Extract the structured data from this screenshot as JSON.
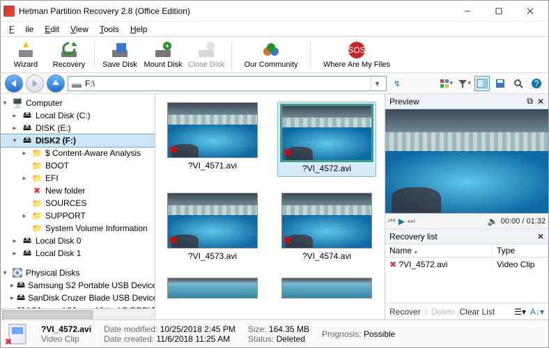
{
  "window": {
    "title": "Hetman Partition Recovery 2.8 (Office Edition)"
  },
  "menu": {
    "file": "File",
    "edit": "Edit",
    "view": "View",
    "tools": "Tools",
    "help": "Help"
  },
  "toolbar": {
    "wizard": "Wizard",
    "recovery": "Recovery",
    "save_disk": "Save Disk",
    "mount_disk": "Mount Disk",
    "close_disk": "Close Disk",
    "community": "Our Community",
    "where": "Where Are My Files"
  },
  "address": {
    "path": "F:\\"
  },
  "tree": {
    "computer": "Computer",
    "local_c": "Local Disk (C:)",
    "disk_e": "DISK (E:)",
    "disk2_f": "DISK2 (F:)",
    "content_aware": "$ Content-Aware Analysis",
    "boot": "BOOT",
    "efi": "EFI",
    "new_folder": "New folder",
    "sources": "SOURCES",
    "support": "SUPPORT",
    "svi": "System Volume Information",
    "ld0": "Local Disk 0",
    "ld1": "Local Disk 1",
    "physical": "Physical Disks",
    "samsung": "Samsung S2 Portable USB Device",
    "sandisk": "SanDisk Cruzer Blade USB Device",
    "vmware": "VMware, VMware Virtual S SCSI Di"
  },
  "files": [
    {
      "name": "?VI_4571.avi"
    },
    {
      "name": "?VI_4572.avi"
    },
    {
      "name": "?VI_4573.avi"
    },
    {
      "name": "?VI_4574.avi"
    }
  ],
  "preview": {
    "title": "Preview",
    "time": "00:00 / 01:32"
  },
  "recovery_list": {
    "title": "Recovery list",
    "col_name": "Name",
    "col_type": "Type",
    "rows": [
      {
        "name": "?VI_4572.avi",
        "type": "Video Clip"
      }
    ],
    "recover": "Recover",
    "delete": "Delete",
    "clear": "Clear List"
  },
  "status": {
    "filename": "?VI_4572.avi",
    "kind": "Video Clip",
    "dm_label": "Date modified:",
    "dm_value": "10/25/2018 2:45 PM",
    "dc_label": "Date created:",
    "dc_value": "11/6/2018 11:25 AM",
    "size_label": "Size:",
    "size_value": "164.35 MB",
    "status_label": "Status:",
    "status_value": "Deleted",
    "prog_label": "Prognosis:",
    "prog_value": "Possible"
  }
}
